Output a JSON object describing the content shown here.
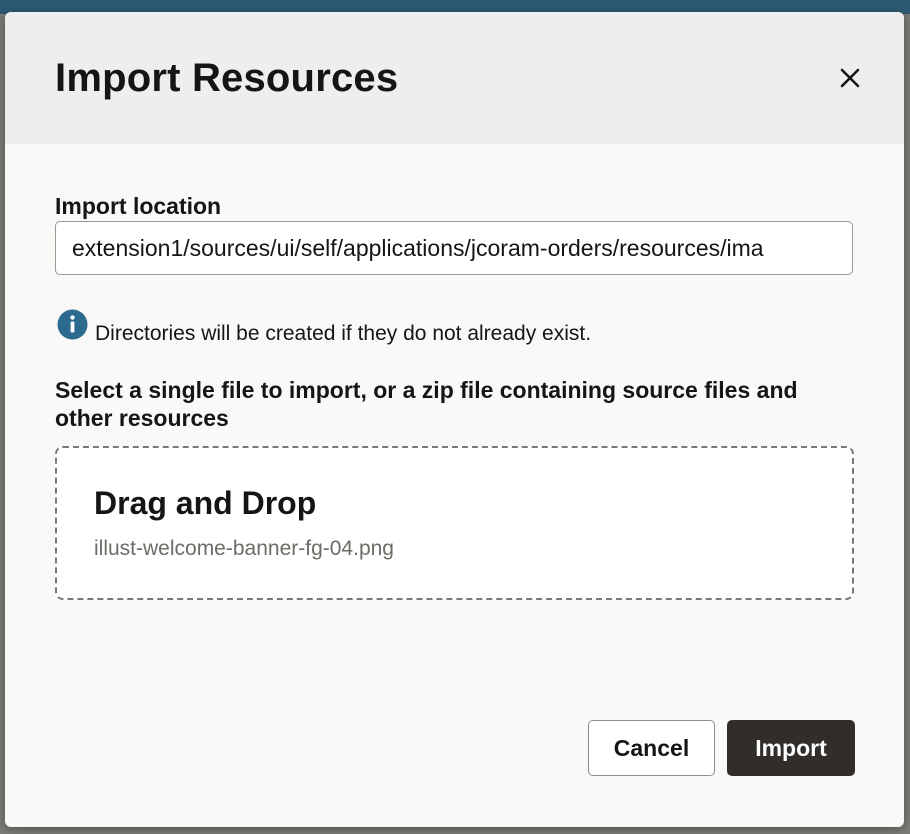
{
  "dialog": {
    "title": "Import Resources",
    "close_icon": "close-icon"
  },
  "import_location": {
    "label": "Import location",
    "value": "extension1/sources/ui/self/applications/jcoram-orders/resources/ima"
  },
  "info": {
    "icon": "info-icon",
    "text": "Directories will be created if they do not already exist."
  },
  "file_select": {
    "label": "Select a single file to import, or a zip file containing source files and other resources",
    "dropzone_title": "Drag and Drop",
    "selected_file": "illust-welcome-banner-fg-04.png"
  },
  "buttons": {
    "cancel": "Cancel",
    "import": "Import"
  },
  "colors": {
    "primary_button": "#312d2a",
    "info_icon": "#2c6a8f",
    "header_bg": "#eeeeec"
  }
}
